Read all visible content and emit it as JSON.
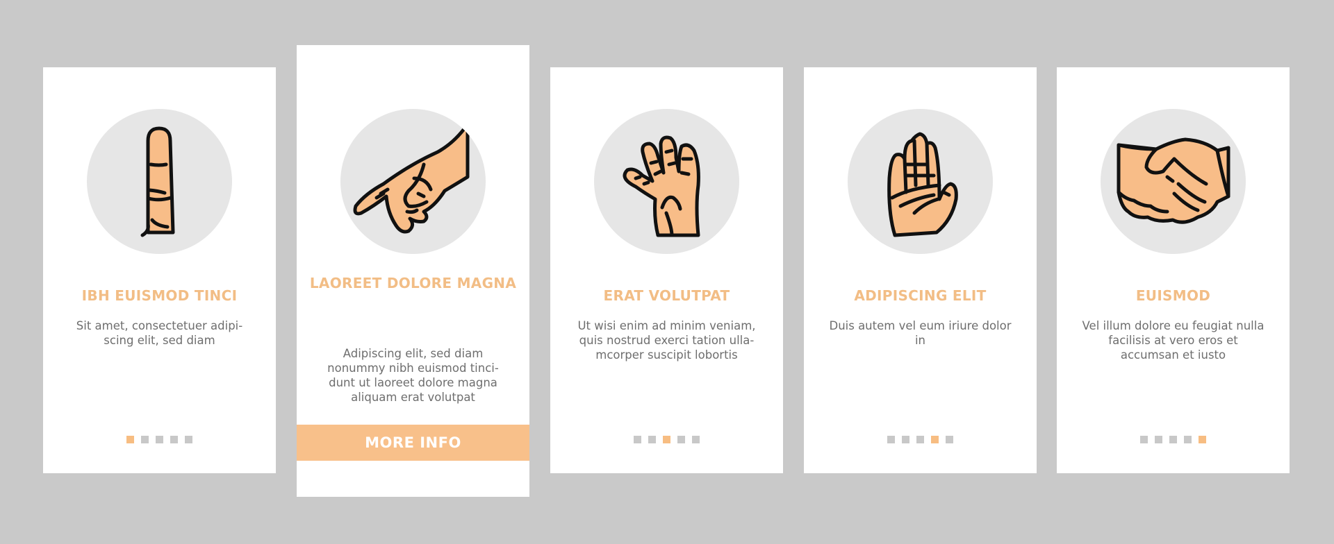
{
  "theme": {
    "background": "#c9c9c9",
    "card": "#ffffff",
    "accent": "#f7bd82",
    "title_color": "#f2bd85",
    "text_color": "#6e6e6e",
    "dot_inactive": "#c8c8c8",
    "icon_circle": "#e6e6e6",
    "skin": "#f8bd88"
  },
  "cards": [
    {
      "icon": "raised-finger-icon",
      "title": "IBH EUISMOD TINCI",
      "description": "Sit amet, consectetuer adipi-scing elit, sed diam",
      "active_page": 1,
      "total_pages": 5
    },
    {
      "icon": "pointing-hand-icon",
      "title": "LAOREET DOLORE MAGNA",
      "description": "Adipiscing elit, sed diam nonummy nibh euismod tinci-dunt ut laoreet dolore magna aliquam erat volutpat",
      "button_label": "MORE INFO"
    },
    {
      "icon": "spread-hand-icon",
      "title": "ERAT VOLUTPAT",
      "description": "Ut wisi enim ad minim veniam, quis nostrud exerci tation ulla-mcorper suscipit lobortis",
      "active_page": 3,
      "total_pages": 5
    },
    {
      "icon": "palm-hand-icon",
      "title": "ADIPISCING ELIT",
      "description": "Duis autem vel eum iriure dolor in",
      "active_page": 4,
      "total_pages": 5
    },
    {
      "icon": "handshake-icon",
      "title": "EUISMOD",
      "description": "Vel illum dolore eu feugiat nulla facilisis at vero eros et accumsan et iusto",
      "active_page": 5,
      "total_pages": 5
    }
  ]
}
